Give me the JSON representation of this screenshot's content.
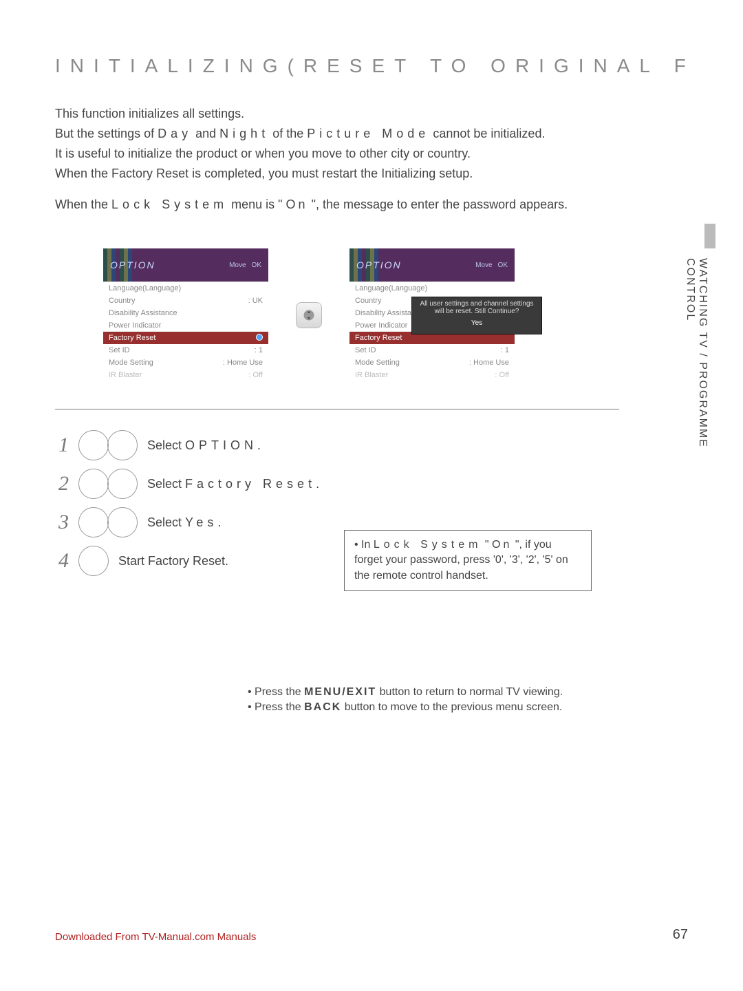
{
  "title": "INITIALIZING(RESET TO ORIGINAL FACTORY SETTINGS)",
  "intro": {
    "l1": "This function initializes all settings.",
    "l2_a": "But the settings of ",
    "l2_day": "Day",
    "l2_b": " and ",
    "l2_night": "Night",
    "l2_c": " of the ",
    "l2_pm": "Picture Mode",
    "l2_d": " cannot be initialized.",
    "l3": "It is useful to initialize the product or when you move to other city or country.",
    "l4": "When the Factory Reset is completed, you must restart the Initializing setup.",
    "l5_a": "When the ",
    "l5_ls": "Lock System",
    "l5_b": " menu is \"",
    "l5_on": "On",
    "l5_c": "\", the message to enter the password appears."
  },
  "sidetab": "WATCHING TV / PROGRAMME CONTROL",
  "screen": {
    "title": "OPTION",
    "move": "Move",
    "ok": "OK",
    "rows": {
      "lang": "Language(Language)",
      "country": "Country",
      "country_v": ": UK",
      "da": "Disability Assistance",
      "pi": "Power Indicator",
      "fr": "Factory Reset",
      "sid": "Set ID",
      "sid_v": ": 1",
      "ms": "Mode Setting",
      "ms_v": ": Home Use",
      "ir": "IR Blaster",
      "ir_v": ": Off"
    },
    "popup": {
      "msg": "All user settings and channel settings will be reset. Still Continue?",
      "yes": "Yes"
    }
  },
  "steps": {
    "s1_a": "Select ",
    "s1_b": "OPTION",
    "s1_c": ".",
    "s2_a": "Select ",
    "s2_b": "Factory Reset",
    "s2_c": ".",
    "s3_a": "Select ",
    "s3_b": "Yes",
    "s3_c": ".",
    "s4": "Start Factory Reset."
  },
  "tip": {
    "a": "• In ",
    "b": "Lock System",
    "c": " \"",
    "d": "On",
    "e": "\", if you forget your password, press '0', '3', '2', '5' on the remote control handset."
  },
  "footer": {
    "n1_a": "• Press the ",
    "n1_b": "MENU/EXIT",
    "n1_c": " button to return to normal TV viewing.",
    "n2_a": "• Press the ",
    "n2_b": "BACK",
    "n2_c": " button to move to the previous menu screen."
  },
  "pagenum": "67",
  "download": "Downloaded From TV-Manual.com Manuals"
}
